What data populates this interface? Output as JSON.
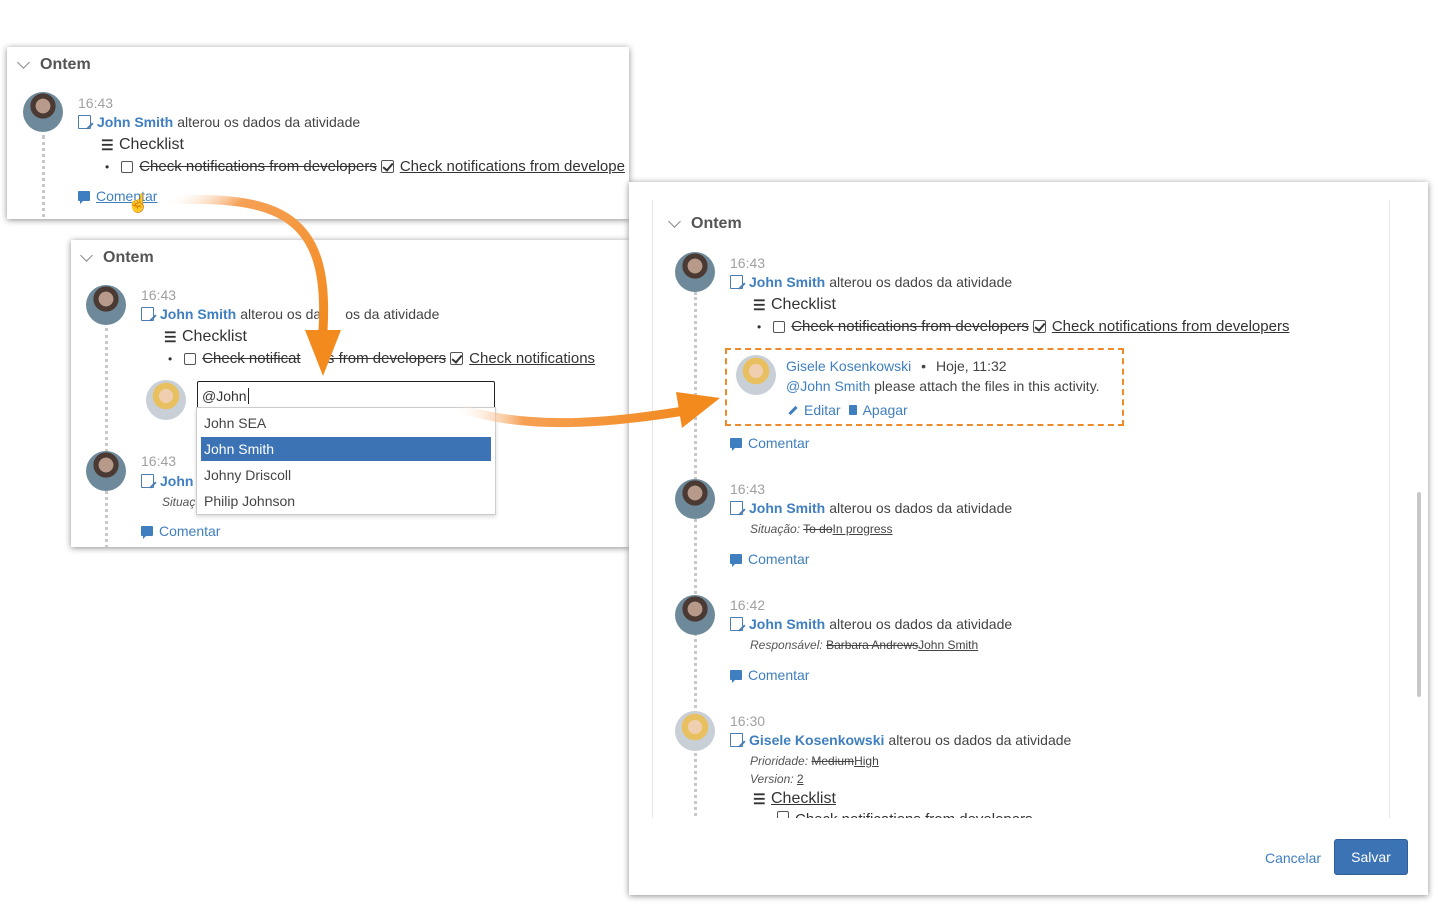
{
  "panel1": {
    "group": "Ontem",
    "time": "16:43",
    "author": "John Smith",
    "action": "alterou os dados da atividade",
    "checklist_label": "Checklist",
    "old_item": "Check notifications from developers",
    "new_item": "Check notifications from develope",
    "comment": "Comentar"
  },
  "panel2": {
    "group": "Ontem",
    "entry1": {
      "time": "16:43",
      "author": "John Smith",
      "action": "alterou os da",
      "action_tail": "os da atividade",
      "checklist_label": "Checklist",
      "old_item": "Check notificat",
      "old_item_tail": "ns from developers",
      "new_item": "Check notifications"
    },
    "input_value": "@John",
    "suggestions": [
      "John SEA",
      "John Smith",
      "Johny Driscoll",
      "Philip Johnson"
    ],
    "entry2": {
      "time": "16:43",
      "author": "John",
      "sub": "Situaç"
    },
    "comment": "Comentar"
  },
  "panel3": {
    "group": "Ontem",
    "e1": {
      "time": "16:43",
      "author": "John Smith",
      "action": "alterou os dados da atividade",
      "checklist_label": "Checklist",
      "old_item": "Check notifications from developers",
      "new_item": "Check notifications from developers"
    },
    "comment_box": {
      "name": "Gisele Kosenkowski",
      "sep": "•",
      "when": "Hoje, 11:32",
      "mention": "@John Smith",
      "text": "please attach the files in this activity.",
      "edit": "Editar",
      "delete": "Apagar"
    },
    "comment_label": "Comentar",
    "e2": {
      "time": "16:43",
      "author": "John Smith",
      "action": "alterou os dados da atividade",
      "field": "Situação:",
      "old": "To do",
      "new": "In progress"
    },
    "e3": {
      "time": "16:42",
      "author": "John Smith",
      "action": "alterou os dados da atividade",
      "field": "Responsável:",
      "old": "Barbara Andrews",
      "new": "John Smith"
    },
    "e4": {
      "time": "16:30",
      "author": "Gisele Kosenkowski",
      "action": "alterou os dados da atividade",
      "field1": "Prioridade:",
      "old1": "Medium",
      "new1": "High",
      "field2": "Version:",
      "new2": "2",
      "checklist_label": "Checklist",
      "cut_item": "Check notifications from developers"
    },
    "cancel": "Cancelar",
    "save": "Salvar"
  },
  "colors": {
    "link": "#3f7fbf",
    "highlight": "#3c73b5",
    "arrow": "#f28a1e",
    "dashed_border": "#ee8a2a"
  }
}
